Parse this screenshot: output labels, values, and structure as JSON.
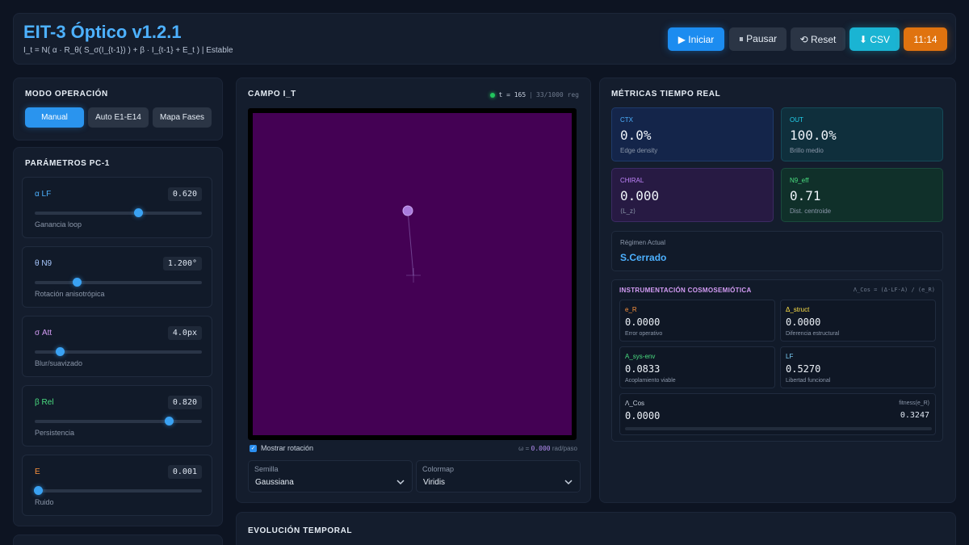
{
  "header": {
    "title": "EIT-3 Óptico v1.2.1",
    "formula": "I_t = N( α · R_θ( S_σ(I_{t-1}) ) + β · I_{t-1} + E_t ) | Estable",
    "buttons": {
      "start": "▶ Iniciar",
      "pause": "⏸ Pausar",
      "reset": "⟲ Reset",
      "csv": "⬇ CSV",
      "clock": "11:14"
    }
  },
  "mode": {
    "title": "MODO OPERACIÓN",
    "options": [
      "Manual",
      "Auto E1-E14",
      "Mapa Fases"
    ],
    "selected": "Manual"
  },
  "params": {
    "title": "PARÁMETROS PC-1",
    "items": [
      {
        "name": "α LF",
        "value": "0.620",
        "desc": "Ganancia loop",
        "level": 0.62,
        "color": "#4db1ff"
      },
      {
        "name": "θ N9",
        "value": "1.200°",
        "desc": "Rotación anisotrópica",
        "level": 0.25,
        "color": "#a8c8ff"
      },
      {
        "name": "σ Att",
        "value": "4.0px",
        "desc": "Blur/suavizado",
        "level": 0.15,
        "color": "#d49cf5"
      },
      {
        "name": "β Rel",
        "value": "0.820",
        "desc": "Persistencia",
        "level": 0.8,
        "color": "#4ade80"
      },
      {
        "name": "E",
        "value": "0.001",
        "desc": "Ruido",
        "level": 0.02,
        "color": "#fb923c"
      }
    ]
  },
  "field": {
    "title": "CAMPO I_T",
    "time": "t = 165",
    "records": "33/1000 reg",
    "show_rotation": "Mostrar rotación",
    "omega_prefix": "ω =",
    "omega_value": "0.000",
    "omega_unit": "rad/paso",
    "seed_label": "Semilla",
    "seed_value": "Gaussiana",
    "colormap_label": "Colormap",
    "colormap_value": "Viridis",
    "background": "#440154"
  },
  "metrics": {
    "title": "MÉTRICAS TIEMPO REAL",
    "cards": [
      {
        "label": "CTX",
        "value": "0.0%",
        "sub": "Edge density",
        "color": "#4db1ff"
      },
      {
        "label": "OUT",
        "value": "100.0%",
        "sub": "Brillo medio",
        "color": "#22d3ee"
      },
      {
        "label": "CHIRAL",
        "value": "0.000",
        "sub": "⟨L_z⟩",
        "color": "#c084fc"
      },
      {
        "label": "N9_eff",
        "value": "0.71",
        "sub": "Dist. centroide",
        "color": "#4ade80"
      }
    ],
    "regime_label": "Régimen Actual",
    "regime_value": "S.Cerrado"
  },
  "instrumentation": {
    "title": "INSTRUMENTACIÓN COSMOSEMIÓTICA",
    "formula": "Λ_Cos = (Δ·LF·A) / (e_R)",
    "items": [
      {
        "label": "e_R",
        "value": "0.0000",
        "desc": "Error operativo",
        "color": "#fb923c"
      },
      {
        "label": "Δ_struct",
        "value": "0.0000",
        "desc": "Diferencia estructural",
        "color": "#fde047"
      },
      {
        "label": "A_sys-env",
        "value": "0.0833",
        "desc": "Acoplamiento viable",
        "color": "#4ade80"
      },
      {
        "label": "LF",
        "value": "0.5270",
        "desc": "Libertad funcional",
        "color": "#7dd3fc"
      }
    ],
    "lambda_label": "Λ_Cos",
    "lambda_value": "0.0000",
    "fitness_label": "fitness(e_R)",
    "fitness_value": "0.3247"
  },
  "evolution": {
    "title": "EVOLUCIÓN TEMPORAL"
  }
}
